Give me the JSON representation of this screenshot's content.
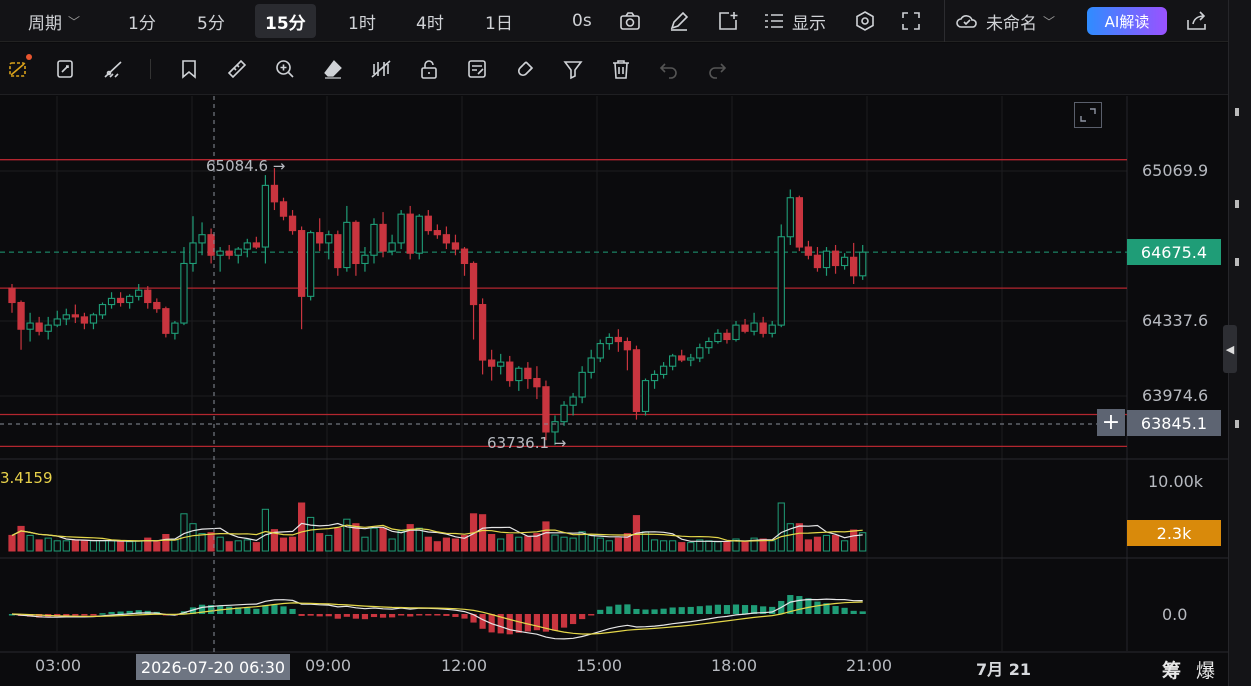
{
  "toolbar": {
    "period_label": "周期",
    "intervals": [
      "1分",
      "5分",
      "15分",
      "1时",
      "4时",
      "1日"
    ],
    "selected_interval": "15分",
    "countdown": "0s",
    "display_label": "显示",
    "layout_name": "未命名",
    "ai_label": "AI解读"
  },
  "price_axis": {
    "ticks": [
      "65069.9",
      "64337.6",
      "63974.6"
    ],
    "current_price": "64675.4",
    "cross_price": "63845.1"
  },
  "annotations": {
    "high_label": "65084.6 →",
    "low_label": "63736.1 →"
  },
  "volume_pane": {
    "indicator_value": "3.4159",
    "axis_top": "10.00k",
    "current_volume": "2.3k"
  },
  "macd_pane": {
    "zero_label": "0.0"
  },
  "time_axis": {
    "labels": [
      "03:00",
      "09:00",
      "12:00",
      "15:00",
      "18:00",
      "21:00",
      "7月 21"
    ],
    "crosshair_time": "2026-07-20 06:30"
  },
  "corner": {
    "left": "筹",
    "right": "爆"
  },
  "colors": {
    "up": "#1f9d77",
    "down": "#c9353f",
    "current_price_bg": "#1f9d77",
    "volume_tag_bg": "#d98a0b",
    "level_line": "#b3262f"
  },
  "chart_data": {
    "type": "candlestick",
    "interval": "15m",
    "high_marker": 65084.6,
    "low_marker": 63736.1,
    "current": 64675.4,
    "support_resistance_levels": [
      65125,
      64500,
      63885,
      63730
    ],
    "candles": [
      [
        64500,
        64520,
        64380,
        64430
      ],
      [
        64430,
        64440,
        64200,
        64300
      ],
      [
        64300,
        64380,
        64240,
        64330
      ],
      [
        64330,
        64360,
        64270,
        64290
      ],
      [
        64290,
        64360,
        64250,
        64320
      ],
      [
        64320,
        64390,
        64310,
        64350
      ],
      [
        64350,
        64400,
        64320,
        64370
      ],
      [
        64370,
        64420,
        64330,
        64360
      ],
      [
        64360,
        64380,
        64300,
        64330
      ],
      [
        64330,
        64380,
        64300,
        64370
      ],
      [
        64370,
        64430,
        64350,
        64420
      ],
      [
        64420,
        64480,
        64400,
        64450
      ],
      [
        64450,
        64480,
        64410,
        64430
      ],
      [
        64430,
        64470,
        64400,
        64460
      ],
      [
        64460,
        64520,
        64440,
        64490
      ],
      [
        64490,
        64510,
        64400,
        64430
      ],
      [
        64430,
        64450,
        64380,
        64400
      ],
      [
        64400,
        64410,
        64260,
        64280
      ],
      [
        64280,
        64340,
        64250,
        64330
      ],
      [
        64330,
        64700,
        64320,
        64620
      ],
      [
        64620,
        64850,
        64580,
        64720
      ],
      [
        64720,
        64820,
        64660,
        64760
      ],
      [
        64760,
        64790,
        64620,
        64660
      ],
      [
        64660,
        64700,
        64580,
        64680
      ],
      [
        64680,
        64710,
        64640,
        64660
      ],
      [
        64660,
        64700,
        64620,
        64690
      ],
      [
        64690,
        64740,
        64650,
        64720
      ],
      [
        64720,
        64750,
        64690,
        64700
      ],
      [
        64700,
        65050,
        64620,
        65000
      ],
      [
        65000,
        65084,
        64880,
        64920
      ],
      [
        64920,
        64940,
        64830,
        64850
      ],
      [
        64850,
        64880,
        64760,
        64780
      ],
      [
        64780,
        64800,
        64300,
        64460
      ],
      [
        64460,
        64780,
        64440,
        64770
      ],
      [
        64770,
        64840,
        64680,
        64720
      ],
      [
        64720,
        64780,
        64640,
        64760
      ],
      [
        64760,
        64780,
        64560,
        64600
      ],
      [
        64600,
        64900,
        64580,
        64820
      ],
      [
        64820,
        64830,
        64560,
        64620
      ],
      [
        64620,
        64700,
        64580,
        64660
      ],
      [
        64660,
        64840,
        64620,
        64810
      ],
      [
        64810,
        64870,
        64650,
        64680
      ],
      [
        64680,
        64760,
        64660,
        64720
      ],
      [
        64720,
        64880,
        64690,
        64860
      ],
      [
        64860,
        64900,
        64640,
        64670
      ],
      [
        64670,
        64860,
        64640,
        64850
      ],
      [
        64850,
        64880,
        64760,
        64780
      ],
      [
        64780,
        64810,
        64740,
        64760
      ],
      [
        64760,
        64800,
        64690,
        64720
      ],
      [
        64720,
        64760,
        64660,
        64690
      ],
      [
        64690,
        64700,
        64560,
        64620
      ],
      [
        64620,
        64630,
        64250,
        64420
      ],
      [
        64420,
        64450,
        64080,
        64150
      ],
      [
        64150,
        64200,
        64050,
        64120
      ],
      [
        64120,
        64180,
        64080,
        64140
      ],
      [
        64140,
        64170,
        64020,
        64050
      ],
      [
        64050,
        64120,
        64000,
        64110
      ],
      [
        64110,
        64140,
        64010,
        64060
      ],
      [
        64060,
        64120,
        63960,
        64020
      ],
      [
        64020,
        64050,
        63760,
        63800
      ],
      [
        63800,
        63880,
        63736,
        63850
      ],
      [
        63850,
        63950,
        63830,
        63930
      ],
      [
        63930,
        63990,
        63880,
        63970
      ],
      [
        63970,
        64120,
        63940,
        64090
      ],
      [
        64090,
        64200,
        64060,
        64160
      ],
      [
        64160,
        64250,
        64140,
        64230
      ],
      [
        64230,
        64280,
        64200,
        64260
      ],
      [
        64260,
        64300,
        64190,
        64240
      ],
      [
        64240,
        64260,
        64100,
        64200
      ],
      [
        64200,
        64220,
        63860,
        63900
      ],
      [
        63900,
        64060,
        63880,
        64050
      ],
      [
        64050,
        64100,
        64010,
        64080
      ],
      [
        64080,
        64140,
        64060,
        64120
      ],
      [
        64120,
        64180,
        64100,
        64170
      ],
      [
        64170,
        64200,
        64140,
        64150
      ],
      [
        64150,
        64180,
        64120,
        64160
      ],
      [
        64160,
        64230,
        64140,
        64210
      ],
      [
        64210,
        64260,
        64180,
        64240
      ],
      [
        64240,
        64300,
        64230,
        64280
      ],
      [
        64280,
        64300,
        64230,
        64250
      ],
      [
        64250,
        64340,
        64240,
        64320
      ],
      [
        64320,
        64350,
        64280,
        64290
      ],
      [
        64290,
        64380,
        64270,
        64330
      ],
      [
        64330,
        64360,
        64260,
        64280
      ],
      [
        64280,
        64340,
        64260,
        64320
      ],
      [
        64320,
        64810,
        64310,
        64750
      ],
      [
        64750,
        64980,
        64710,
        64940
      ],
      [
        64940,
        64950,
        64680,
        64700
      ],
      [
        64700,
        64730,
        64640,
        64660
      ],
      [
        64660,
        64700,
        64580,
        64600
      ],
      [
        64600,
        64700,
        64560,
        64680
      ],
      [
        64680,
        64710,
        64570,
        64610
      ],
      [
        64610,
        64670,
        64590,
        64650
      ],
      [
        64650,
        64720,
        64520,
        64560
      ],
      [
        64560,
        64710,
        64540,
        64675
      ]
    ]
  }
}
